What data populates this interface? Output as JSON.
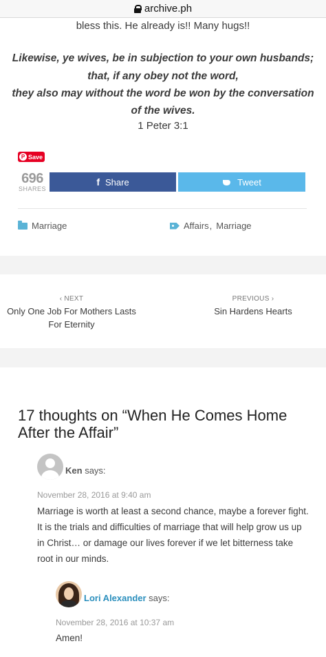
{
  "browser": {
    "domain": "archive.ph"
  },
  "article": {
    "bless_line": "bless this. He already is!! Many hugs!!",
    "verse_lines": [
      "Likewise, ye wives, be in subjection to your own husbands;",
      "that, if any obey not the word,",
      "they also may without the word be won by the conversation",
      "of the wives."
    ],
    "verse_ref": "1 Peter 3:1"
  },
  "share": {
    "pinterest_label": "Save",
    "count": "696",
    "count_label": "SHARES",
    "facebook_label": "Share",
    "twitter_label": "Tweet",
    "facebook_color": "#3b5998",
    "twitter_color": "#5ab8ea"
  },
  "meta": {
    "category": "Marriage",
    "tags": [
      "Affairs",
      "Marriage"
    ]
  },
  "post_nav": {
    "next_kicker": "‹ NEXT",
    "next_title": "Only One Job For Mothers Lasts For Eternity",
    "prev_kicker": "PREVIOUS ›",
    "prev_title": "Sin Hardens Hearts"
  },
  "comments": {
    "title": "17 thoughts on “When He Comes Home After the Affair”",
    "items": [
      {
        "author": "Ken",
        "says": "says:",
        "date": "November 28, 2016 at 9:40 am",
        "lines": [
          "Marriage is worth at least a second chance, maybe a forever fight.",
          "It is the trials and difficulties of marriage that will help grow us up",
          "in Christ… or damage our lives forever if we let bitterness take",
          "root in our minds."
        ]
      },
      {
        "author": "Lori Alexander",
        "says": "says:",
        "date": "November 28, 2016 at 10:37 am",
        "lines": [
          "Amen!"
        ]
      }
    ]
  }
}
